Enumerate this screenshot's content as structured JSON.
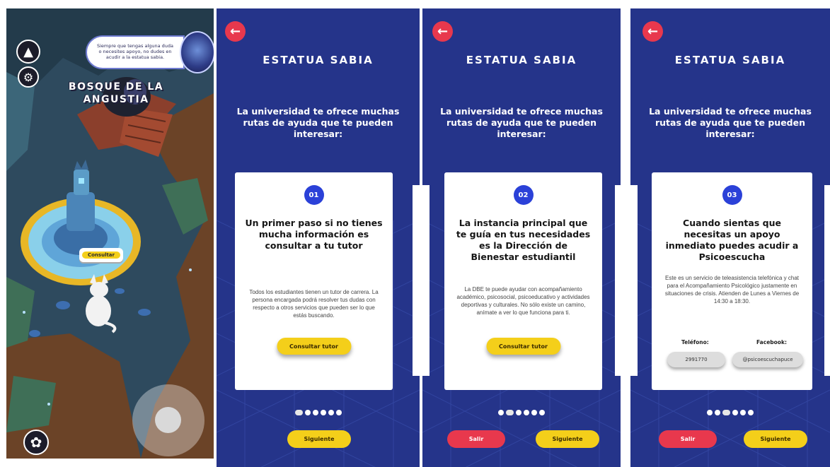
{
  "game": {
    "speech": "Siempre que tengas alguna duda o necesites apoyo, no dudes en acudir a la estatua sabia.",
    "place_title": "BOSQUE DE LA ANGUSTIA",
    "consult_label": "Consultar",
    "icons": {
      "top": "wolf-icon",
      "settings": "gear-icon",
      "paw": "paw-icon"
    }
  },
  "screens": [
    {
      "title": "ESTATUA SABIA",
      "intro": "La universidad te ofrece muchas rutas de ayuda que te pueden interesar:",
      "card": {
        "number": "01",
        "heading": "Un primer paso si no tienes mucha información es consultar a tu tutor",
        "body": "Todos los estudiantes tienen un tutor de carrera. La persona encargada podrá resolver tus dudas con respecto a otros servicios que pueden ser lo que estás buscando.",
        "button": "Consultar tutor"
      },
      "pagination": {
        "total": 6,
        "active": 0
      },
      "next_label": "Siguiente"
    },
    {
      "title": "ESTATUA SABIA",
      "intro": "La universidad te ofrece muchas rutas de ayuda que te pueden interesar:",
      "card": {
        "number": "02",
        "heading": "La instancia principal que te guía en tus necesidades es la Dirección de Bienestar estudiantil",
        "body": "La DBE te puede ayudar con acompañamiento académico, psicosocial, psicoeducativo y actividades deportivas y culturales. No sólo existe un camino, anímate a ver lo que funciona para ti.",
        "button": "Consultar tutor"
      },
      "pagination": {
        "total": 6,
        "active": 1
      },
      "exit_label": "Salir",
      "next_label": "Siguiente"
    },
    {
      "title": "ESTATUA SABIA",
      "intro": "La universidad te ofrece muchas rutas de ayuda que te pueden interesar:",
      "card": {
        "number": "03",
        "heading": "Cuando sientas que necesitas un apoyo inmediato puedes acudir a Psicoescucha",
        "body": "Este es un servicio de teleasistencia telefónica y chat para el Acompañamiento Psicológico justamente en situaciones de crisis. Atienden de Lunes a Viernes de 14:30 a 18:30.",
        "phone_label": "Teléfono:",
        "phone_value": "2991770",
        "facebook_label": "Facebook:",
        "facebook_value": "@psicoescuchapuce"
      },
      "pagination": {
        "total": 6,
        "active": 2
      },
      "exit_label": "Salir",
      "next_label": "Siguiente"
    }
  ],
  "colors": {
    "panel_bg": "#25348a",
    "accent_yellow": "#f4cf1a",
    "exit_red": "#e8384d",
    "badge_blue": "#2b41d8"
  }
}
